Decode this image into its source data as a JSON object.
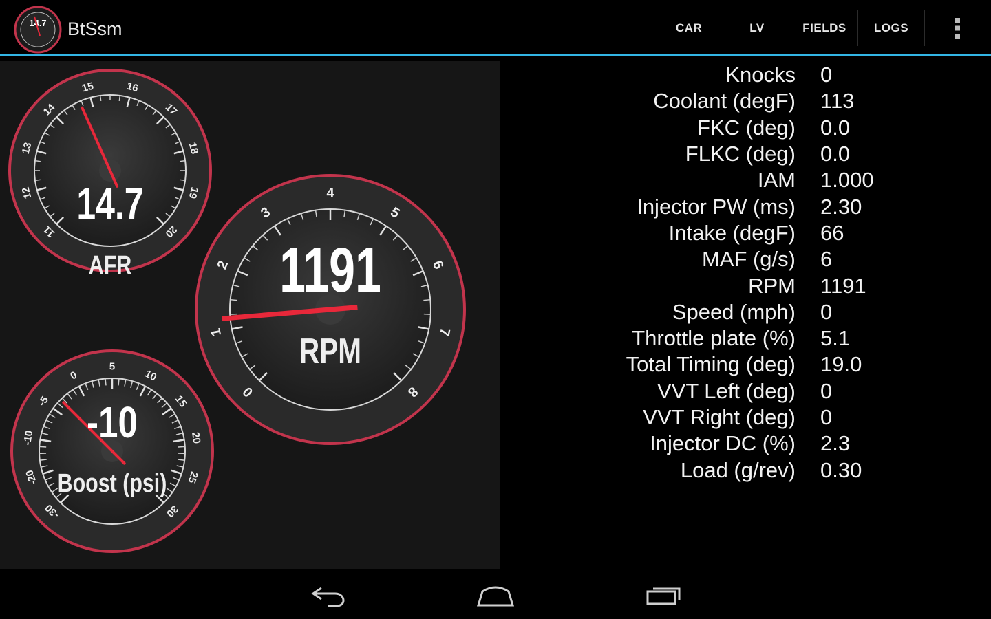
{
  "app": {
    "title": "BtSsm",
    "icon_value": "14.7",
    "icon_name": "gauge-icon"
  },
  "menu": {
    "car": "CAR",
    "lv": "LV",
    "fields": "FIELDS",
    "logs": "LOGS",
    "overflow_icon": "overflow-menu-icon"
  },
  "colors": {
    "accent": "#33b5e5",
    "gauge_ring": "#c2344c",
    "needle": "#e8283a",
    "panel": "#161616"
  },
  "gauges": {
    "afr": {
      "label": "AFR",
      "value_text": "14.7",
      "value": 14.7,
      "min": 11,
      "max": 20,
      "ticks": [
        "11",
        "12",
        "13",
        "14",
        "15",
        "16",
        "17",
        "18",
        "19",
        "20"
      ]
    },
    "rpm": {
      "label": "RPM",
      "value_text": "1191",
      "value": 1.191,
      "min": 0,
      "max": 8,
      "ticks": [
        "0",
        "1",
        "2",
        "3",
        "4",
        "5",
        "6",
        "7",
        "8"
      ]
    },
    "boost": {
      "label": "Boost (psi)",
      "value_text": "-10",
      "value": -10,
      "min": -30,
      "max": 30,
      "ticks": [
        "-30",
        "-20",
        "-10",
        "-5",
        "0",
        "5",
        "10",
        "15",
        "20",
        "25",
        "30"
      ]
    }
  },
  "data_rows": [
    {
      "label": "Knocks",
      "value": "0"
    },
    {
      "label": "Coolant (degF)",
      "value": "113"
    },
    {
      "label": "FKC (deg)",
      "value": "0.0"
    },
    {
      "label": "FLKC (deg)",
      "value": "0.0"
    },
    {
      "label": "IAM",
      "value": "1.000"
    },
    {
      "label": "Injector PW (ms)",
      "value": "2.30"
    },
    {
      "label": "Intake (degF)",
      "value": "66"
    },
    {
      "label": "MAF (g/s)",
      "value": "6"
    },
    {
      "label": "RPM",
      "value": "1191"
    },
    {
      "label": "Speed (mph)",
      "value": "0"
    },
    {
      "label": "Throttle plate (%)",
      "value": "5.1"
    },
    {
      "label": "Total Timing (deg)",
      "value": "19.0"
    },
    {
      "label": "VVT Left (deg)",
      "value": "0"
    },
    {
      "label": "VVT Right (deg)",
      "value": "0"
    },
    {
      "label": "Injector DC (%)",
      "value": "2.3"
    },
    {
      "label": "Load (g/rev)",
      "value": "0.30"
    }
  ],
  "navbar": {
    "back_icon": "back-icon",
    "home_icon": "home-icon",
    "recent_icon": "recent-apps-icon"
  }
}
